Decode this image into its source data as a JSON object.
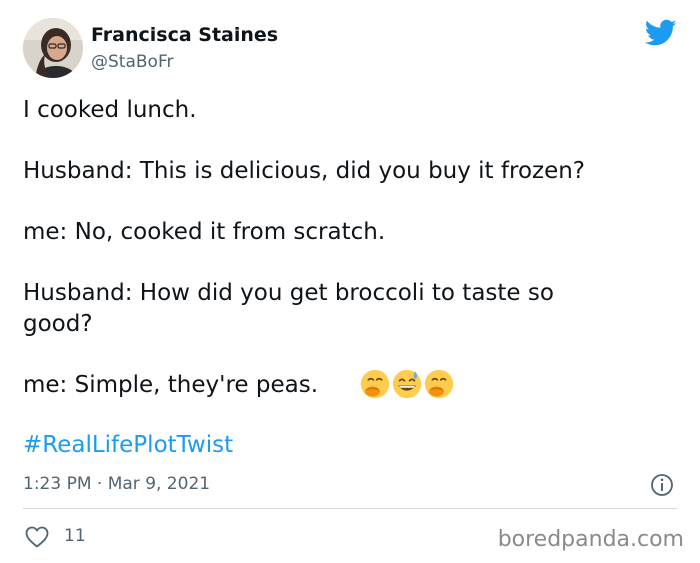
{
  "author": {
    "name": "Francisca Staines",
    "handle": "@StaBoFr"
  },
  "tweet": {
    "lines": [
      "I cooked lunch.",
      "Husband: This is delicious, did you buy it frozen?",
      "me: No, cooked it from scratch.",
      "Husband: How did you get broccoli to taste so",
      "good?",
      "me: Simple, they're peas."
    ],
    "emojis": [
      "hand-over-mouth-emoji",
      "grinning-sweat-emoji",
      "hand-over-mouth-emoji"
    ],
    "hashtag": "#RealLifePlotTwist"
  },
  "meta": {
    "timestamp": "1:23 PM · Mar 9, 2021"
  },
  "actions": {
    "like_count": "11"
  },
  "watermark": "boredpanda.com",
  "colors": {
    "twitter_blue": "#1d9bf0",
    "secondary_text": "#536471",
    "divider": "#cfd9de",
    "watermark": "#8a8a8a"
  },
  "icons": [
    "avatar",
    "twitter-bird-icon",
    "info-icon",
    "heart-icon"
  ]
}
